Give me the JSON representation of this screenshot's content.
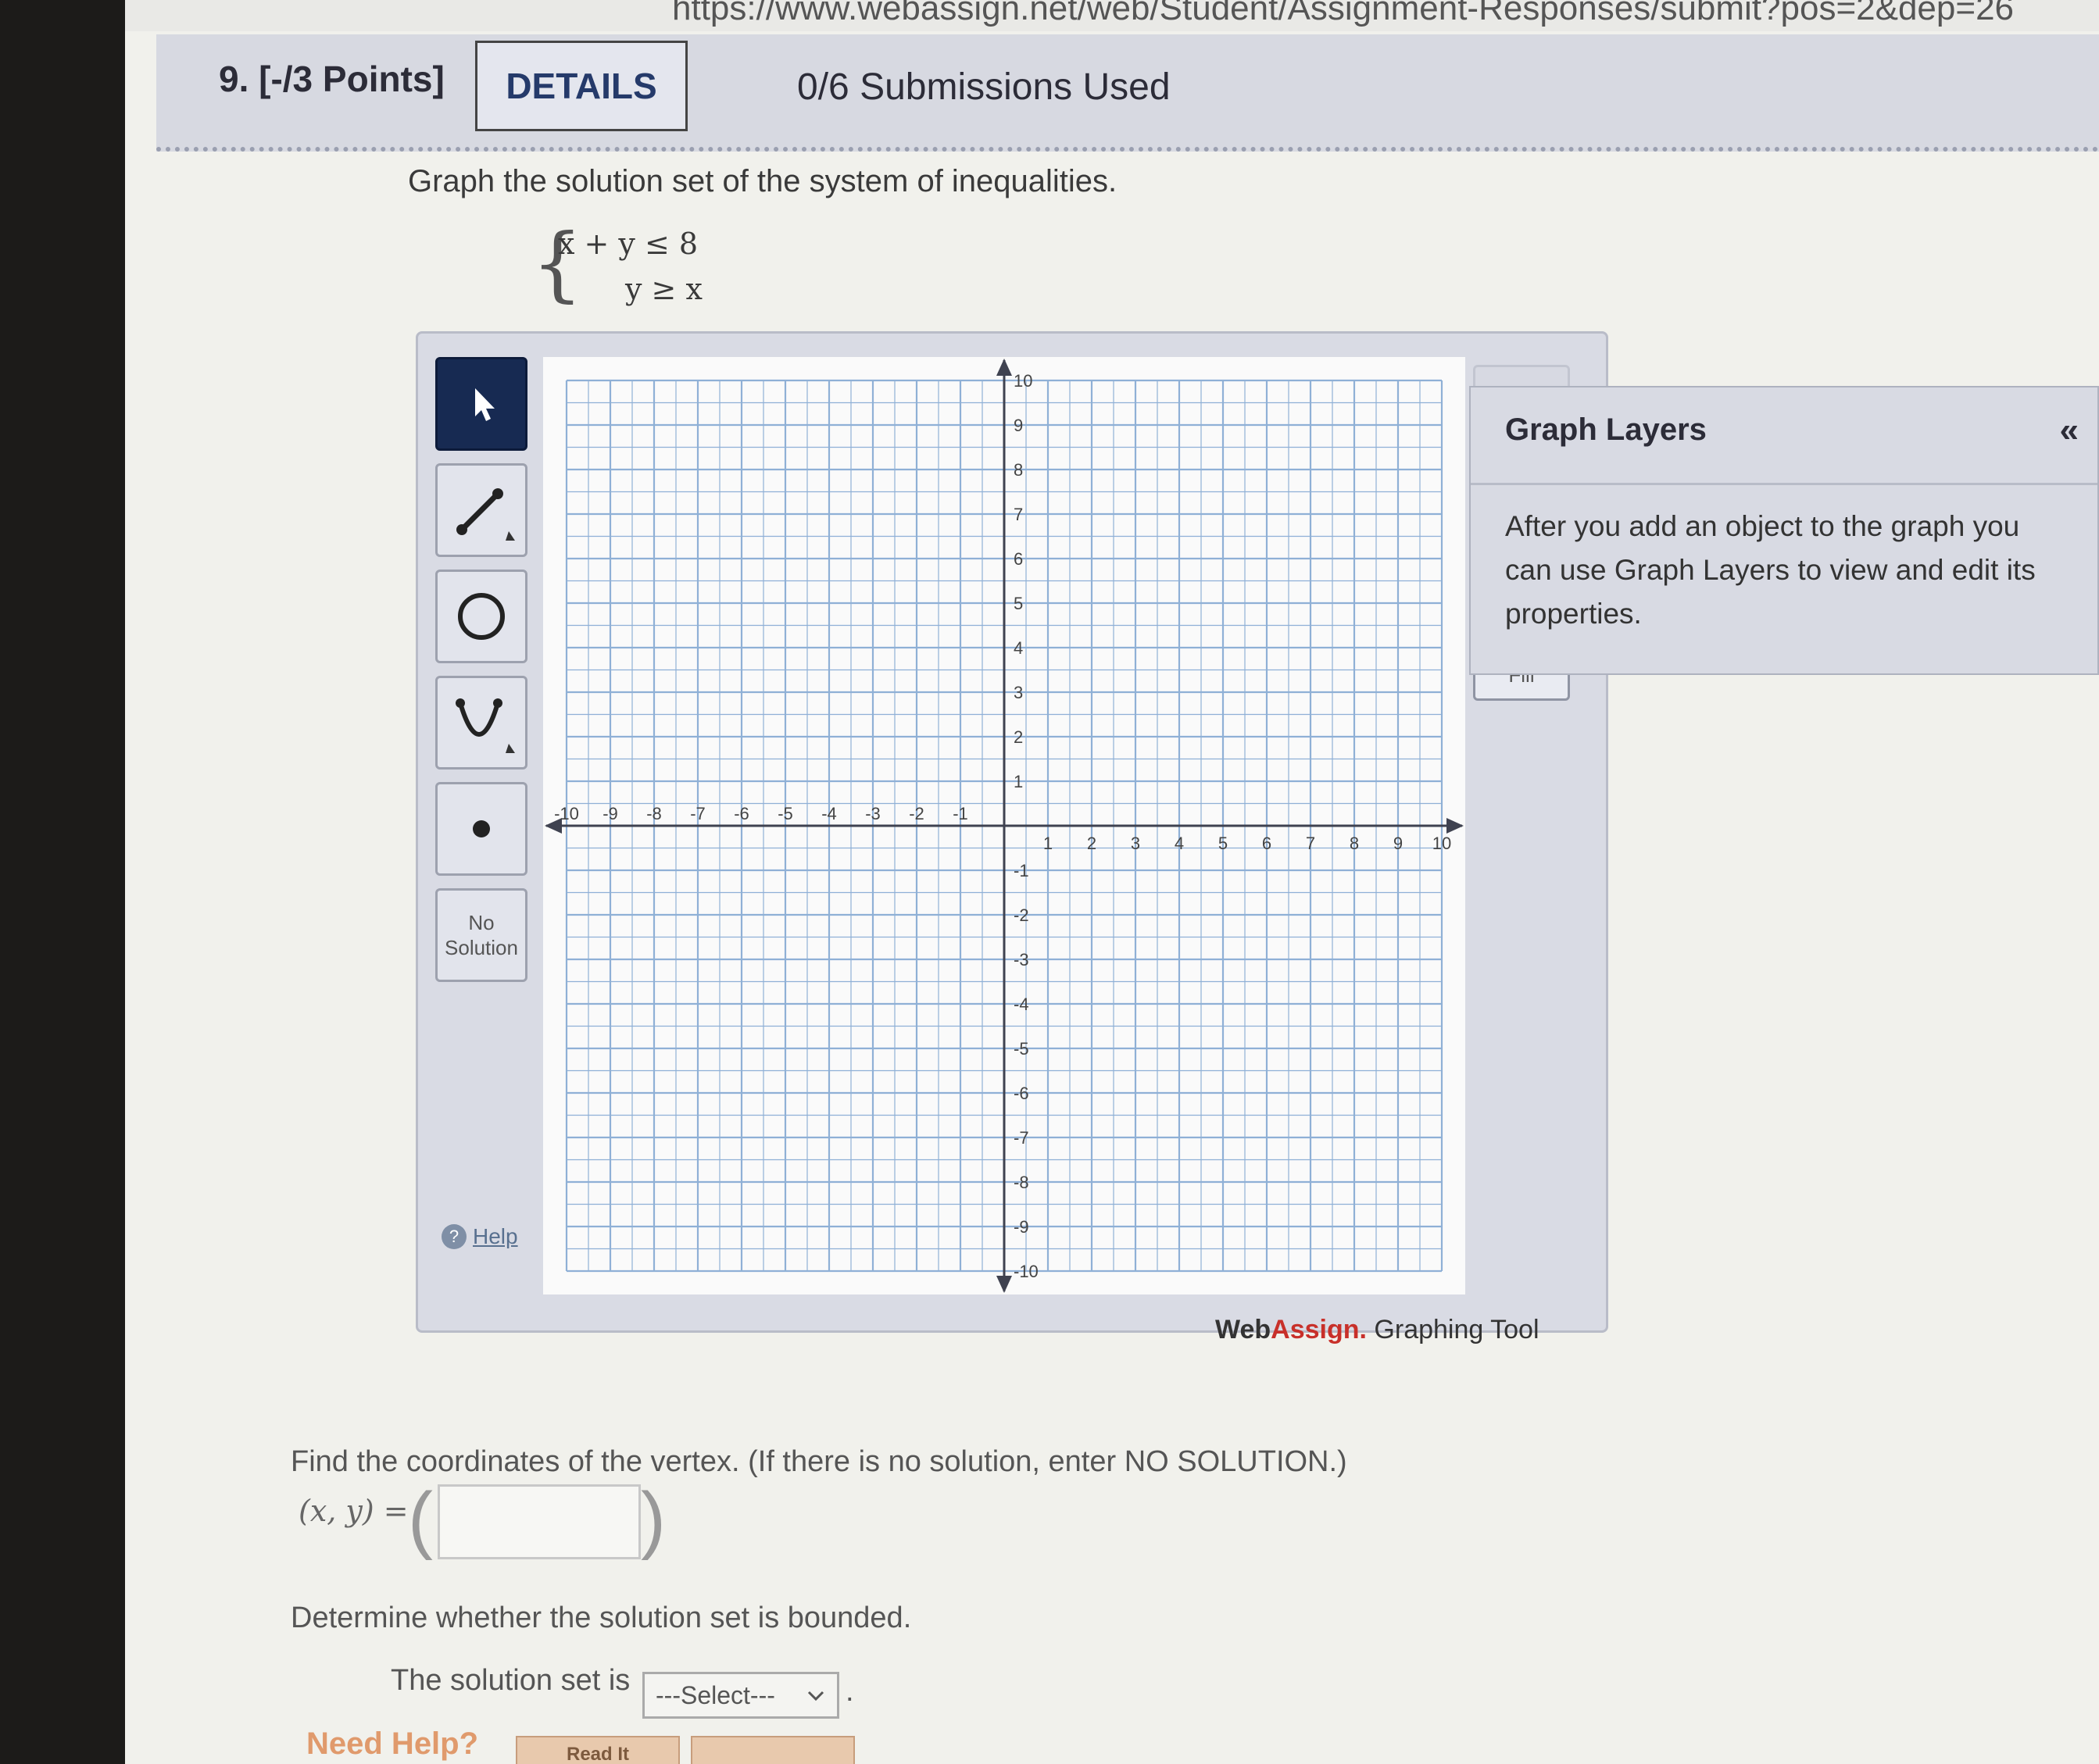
{
  "browser": {
    "url_fragment": "https://www.webassign.net/web/Student/Assignment-Responses/submit?pos=2&dep=26"
  },
  "question": {
    "number_label": "9. [-/3 Points]",
    "details_label": "DETAILS",
    "submissions": "0/6 Submissions Used",
    "prompt": "Graph the solution set of the system of inequalities.",
    "inequality_1": "x + y ≤ 8",
    "inequality_2": "y ≥ x"
  },
  "tools": {
    "no_solution_line1": "No",
    "no_solution_line2": "Solution",
    "help_label": "Help",
    "fill_label": "Fill",
    "brand_web": "Web",
    "brand_assign": "Assign.",
    "brand_tool": "Graphing Tool"
  },
  "graph": {
    "x_min": -10,
    "x_max": 10,
    "y_min": -10,
    "y_max": 10,
    "x_tick_labels": [
      "-10",
      "-9",
      "-8",
      "-7",
      "-6",
      "-5",
      "-4",
      "-3",
      "-2",
      "-1",
      "1",
      "2",
      "3",
      "4",
      "5",
      "6",
      "7",
      "8",
      "9",
      "10"
    ],
    "y_tick_labels": [
      "10",
      "9",
      "8",
      "7",
      "6",
      "5",
      "4",
      "3",
      "2",
      "1",
      "-1",
      "-2",
      "-3",
      "-4",
      "-5",
      "-6",
      "-7",
      "-8",
      "-9",
      "-10"
    ],
    "minor_grid_per_unit": 2,
    "colors": {
      "grid": "#8fb0d6",
      "axis": "#3f4250",
      "background": "#fafafa"
    }
  },
  "layers": {
    "title": "Graph Layers",
    "collapse_icon": "«",
    "description": "After you add an object to the graph you can use Graph Layers to view and edit its properties."
  },
  "vertex": {
    "question": "Find the coordinates of the vertex. (If there is no solution, enter NO SOLUTION.)",
    "label": "(x, y) =",
    "value": ""
  },
  "bounded": {
    "question": "Determine whether the solution set is bounded.",
    "label": "The solution set is",
    "select_value": "---Select---",
    "period": "."
  },
  "help": {
    "need_help": "Need Help?",
    "read_it": "Read It"
  }
}
